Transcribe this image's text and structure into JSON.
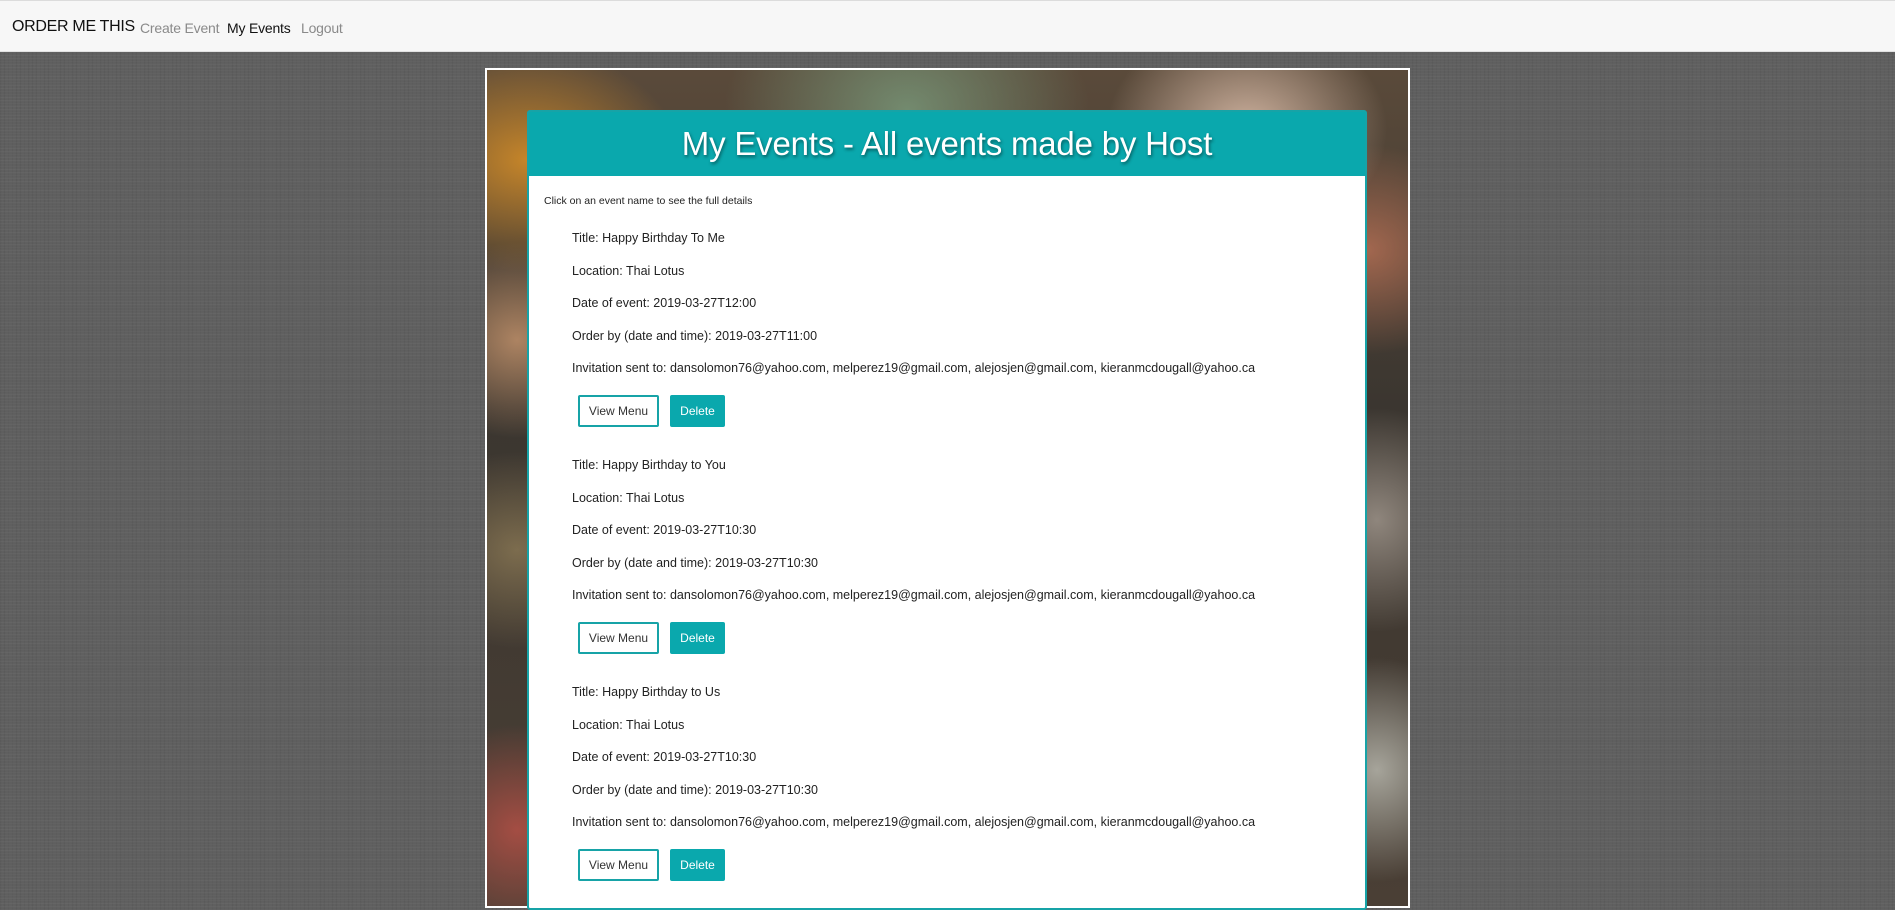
{
  "navbar": {
    "brand": "ORDER ME THIS",
    "links": [
      {
        "label": "Create Event",
        "active": false
      },
      {
        "label": "My Events",
        "active": true
      },
      {
        "label": "Logout",
        "active": false
      }
    ]
  },
  "page": {
    "heading": "My Events - All events made by Host",
    "hint": "Click on an event name to see the full details"
  },
  "labels": {
    "view_menu": "View Menu",
    "delete": "Delete"
  },
  "events": [
    {
      "title": "Title: Happy Birthday To Me",
      "location": "Location: Thai Lotus",
      "date": "Date of event: 2019-03-27T12:00",
      "order_by": "Order by (date and time): 2019-03-27T11:00",
      "invitations": "Invitation sent to: dansolomon76@yahoo.com, melperez19@gmail.com, alejosjen@gmail.com, kieranmcdougall@yahoo.ca"
    },
    {
      "title": "Title: Happy Birthday to You",
      "location": "Location: Thai Lotus",
      "date": "Date of event: 2019-03-27T10:30",
      "order_by": "Order by (date and time): 2019-03-27T10:30",
      "invitations": "Invitation sent to: dansolomon76@yahoo.com, melperez19@gmail.com, alejosjen@gmail.com, kieranmcdougall@yahoo.ca"
    },
    {
      "title": "Title: Happy Birthday to Us",
      "location": "Location: Thai Lotus",
      "date": "Date of event: 2019-03-27T10:30",
      "order_by": "Order by (date and time): 2019-03-27T10:30",
      "invitations": "Invitation sent to: dansolomon76@yahoo.com, melperez19@gmail.com, alejosjen@gmail.com, kieranmcdougall@yahoo.ca"
    }
  ],
  "colors": {
    "accent": "#0aa8ad",
    "background": "#5f5f5f"
  }
}
